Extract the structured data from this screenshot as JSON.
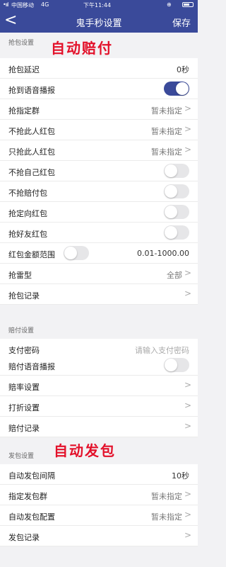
{
  "status_bar": {
    "signal": "•ııl",
    "carrier": "中国移动",
    "network": "4G",
    "time": "下午11:44",
    "lock": "⊕"
  },
  "nav": {
    "back": "<",
    "title": "鬼手秒设置",
    "save": "保存"
  },
  "colors": {
    "accent": "#3a4a9a",
    "overlay_red": "#e3112a"
  },
  "section1": {
    "header": "抢包设置",
    "overlay": "自动赔付",
    "rows": [
      {
        "label": "抢包延迟",
        "value": "0秒"
      },
      {
        "label": "抢到语音播报",
        "toggle": true
      },
      {
        "label": "抢指定群",
        "value": "暂未指定"
      },
      {
        "label": "不抢此人红包",
        "value": "暂未指定"
      },
      {
        "label": "只抢此人红包",
        "value": "暂未指定"
      },
      {
        "label": "不抢自己红包",
        "toggle": false
      },
      {
        "label": "不抢赔付包",
        "toggle": false
      },
      {
        "label": "抢定向红包",
        "toggle": false
      },
      {
        "label": "抢好友红包",
        "toggle": false
      },
      {
        "label": "红包金额范围",
        "value": "0.01-1000.00",
        "toggle": false
      },
      {
        "label": "抢雷型",
        "value": "全部"
      },
      {
        "label": "抢包记录"
      }
    ]
  },
  "section2": {
    "header": "赔付设置",
    "rows": [
      {
        "label": "支付密码",
        "placeholder": "请输入支付密码"
      },
      {
        "label": "赔付语音播报",
        "toggle": false
      },
      {
        "label": "赔率设置"
      },
      {
        "label": "打折设置"
      },
      {
        "label": "赔付记录"
      }
    ]
  },
  "section3": {
    "header": "发包设置",
    "overlay": "自动发包",
    "rows": [
      {
        "label": "自动发包间隔",
        "value": "10秒"
      },
      {
        "label": "指定发包群",
        "value": "暂未指定"
      },
      {
        "label": "自动发包配置",
        "value": "暂未指定"
      },
      {
        "label": "发包记录"
      }
    ]
  },
  "chevron": ">"
}
